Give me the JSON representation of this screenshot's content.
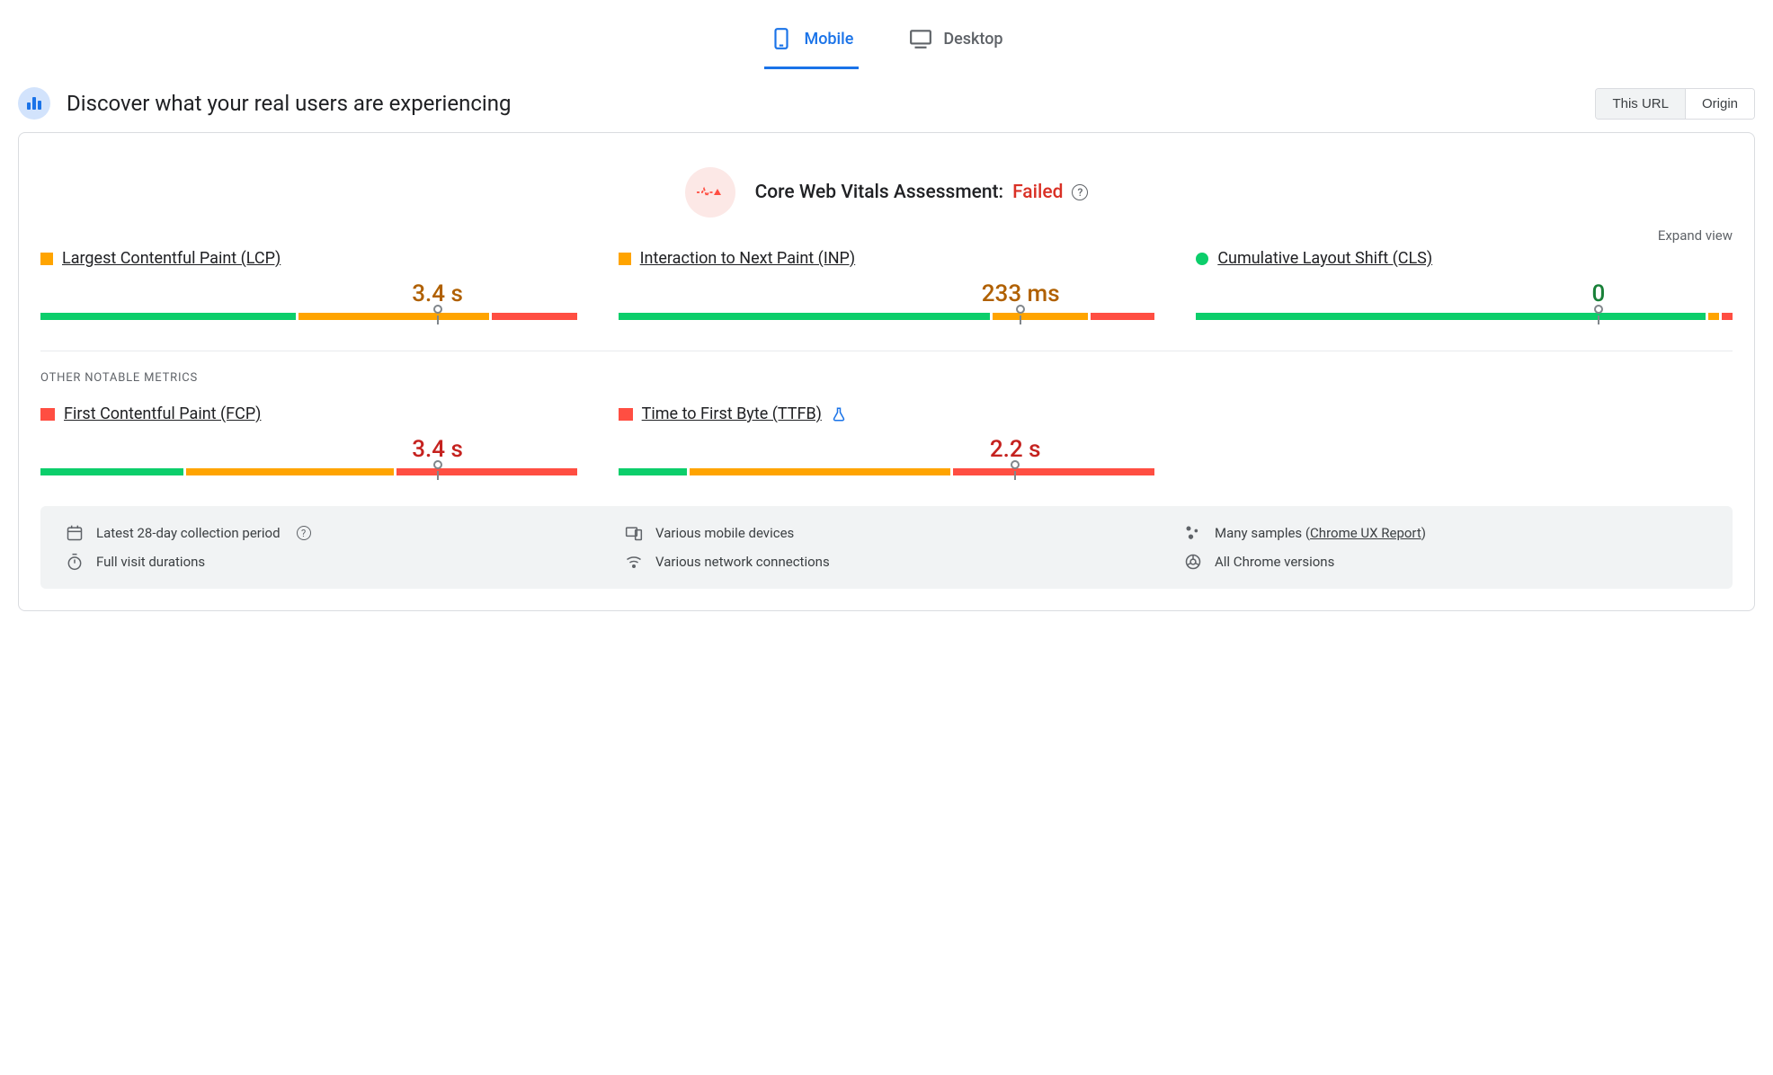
{
  "tabs": {
    "mobile": "Mobile",
    "desktop": "Desktop"
  },
  "header": {
    "title": "Discover what your real users are experiencing",
    "seg_url": "This URL",
    "seg_origin": "Origin"
  },
  "assessment": {
    "label": "Core Web Vitals Assessment:",
    "status": "Failed"
  },
  "expand": "Expand view",
  "section_other": "OTHER NOTABLE METRICS",
  "metrics": {
    "lcp": {
      "name": "Largest Contentful Paint (LCP)",
      "value": "3.4 s",
      "status": "orange",
      "shape": "square",
      "bar": {
        "green": 48,
        "orange": 36,
        "red": 16
      },
      "marker_pct": 74
    },
    "inp": {
      "name": "Interaction to Next Paint (INP)",
      "value": "233 ms",
      "status": "orange",
      "shape": "square",
      "bar": {
        "green": 70,
        "orange": 18,
        "red": 12
      },
      "marker_pct": 75
    },
    "cls": {
      "name": "Cumulative Layout Shift (CLS)",
      "value": "0",
      "status": "green",
      "shape": "circle",
      "bar": {
        "green": 96,
        "orange": 2,
        "red": 2
      },
      "marker_pct": 75
    },
    "fcp": {
      "name": "First Contentful Paint (FCP)",
      "value": "3.4 s",
      "status": "red",
      "shape": "triangle",
      "bar": {
        "green": 27,
        "orange": 39,
        "red": 34
      },
      "marker_pct": 74
    },
    "ttfb": {
      "name": "Time to First Byte (TTFB)",
      "value": "2.2 s",
      "status": "red",
      "shape": "triangle",
      "experimental": true,
      "bar": {
        "green": 13,
        "orange": 49,
        "red": 38
      },
      "marker_pct": 74
    }
  },
  "info": {
    "period": "Latest 28-day collection period",
    "devices": "Various mobile devices",
    "samples_prefix": "Many samples (",
    "samples_link": "Chrome UX Report",
    "samples_suffix": ")",
    "durations": "Full visit durations",
    "network": "Various network connections",
    "versions": "All Chrome versions"
  }
}
